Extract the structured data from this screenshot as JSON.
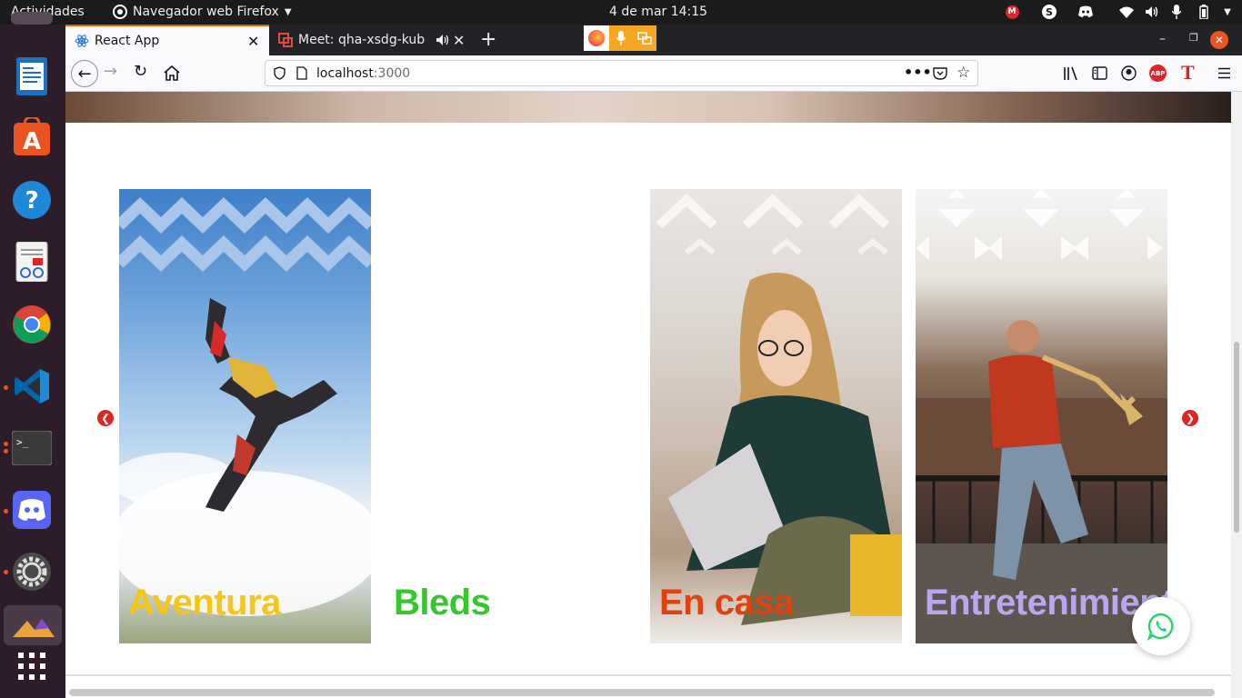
{
  "topbar": {
    "activities": "Actividades",
    "app_menu": "Navegador web Firefox",
    "clock": "4 de mar  14:15"
  },
  "browser": {
    "tabs": [
      {
        "label": "React App"
      },
      {
        "label": "Meet: qha-xsdg-kub"
      }
    ],
    "url_host": "localhost",
    "url_port": ":3000"
  },
  "page": {
    "cards": [
      {
        "title": "Aventura",
        "title_color": "#f5c518"
      },
      {
        "title": "Bleds",
        "title_color": "#36c72e"
      },
      {
        "title": "En casa",
        "title_color": "#e0420f"
      },
      {
        "title": "Entretenimiento",
        "title_color": "#b9a6ef"
      }
    ]
  },
  "icons": {
    "dock": [
      "text-editor-icon",
      "software-store-icon",
      "help-icon",
      "document-viewer-icon",
      "chrome-icon",
      "vscode-icon",
      "terminal-icon",
      "discord-icon",
      "settings-icon",
      "app-icon",
      "show-apps-icon"
    ],
    "tray": [
      "mega-icon",
      "skype-icon",
      "discord-tray-icon",
      "wifi-icon",
      "volume-icon",
      "mic-icon",
      "battery-icon",
      "power-menu-icon"
    ],
    "toolbar": [
      "back-icon",
      "forward-icon",
      "reload-icon",
      "home-icon",
      "shield-icon",
      "page-icon",
      "more-icon",
      "pocket-icon",
      "bookmark-star-icon",
      "library-icon",
      "sidebar-icon",
      "account-icon",
      "adblock-icon",
      "t-extension-icon",
      "menu-icon"
    ]
  },
  "colors": {
    "accent": "#e66000",
    "arrow": "#e02424",
    "whatsapp": "#25d366"
  }
}
